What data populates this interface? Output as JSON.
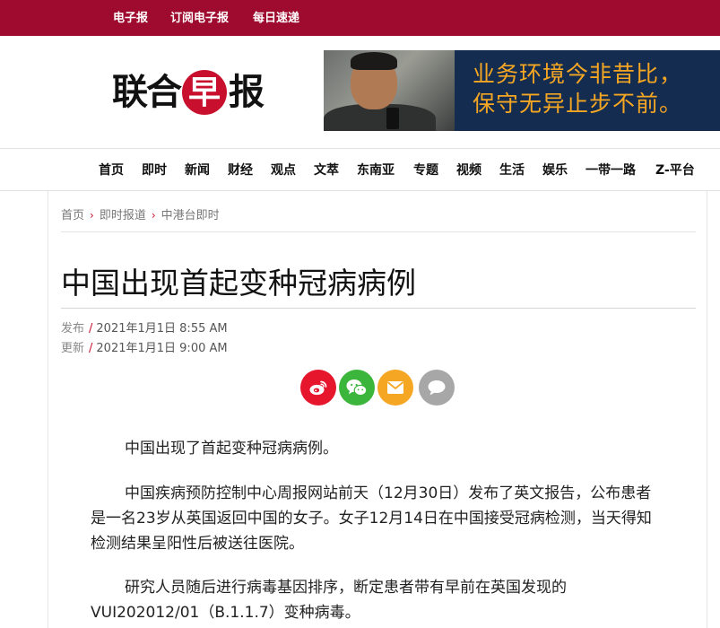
{
  "topbar": {
    "links": [
      "电子报",
      "订阅电子报",
      "每日速递"
    ]
  },
  "logo": {
    "chars": [
      "联",
      "合",
      "早",
      "报"
    ]
  },
  "banner": {
    "line1": "业务环境今非昔比，",
    "line2": "保守无异止步不前。"
  },
  "nav": {
    "items": [
      "首页",
      "即时",
      "新闻",
      "财经",
      "观点",
      "文萃",
      "东南亚",
      "专题",
      "视频",
      "生活",
      "娱乐",
      "一带一路",
      "Z-平台"
    ]
  },
  "breadcrumb": {
    "items": [
      "首页",
      "即时报道",
      "中港台即时"
    ],
    "separator": "›"
  },
  "article": {
    "title": "中国出现首起变种冠病病例",
    "published_label": "发布",
    "published": "2021年1月1日 8:55 AM",
    "updated_label": "更新",
    "updated": "2021年1月1日 9:00 AM",
    "meta_slash": "/",
    "paragraphs": [
      "中国出现了首起变种冠病病例。",
      "中国疾病预防控制中心周报网站前天（12月30日）发布了英文报告，公布患者是一名23岁从英国返回中国的女子。女子12月14日在中国接受冠病检测，当天得知检测结果呈阳性后被送往医院。",
      "研究人员随后进行病毒基因排序，断定患者带有早前在英国发现的VUI202012/01（B.1.1.7）变种病毒。"
    ]
  },
  "share": [
    {
      "icon": "weibo-icon",
      "color": "#e6162d"
    },
    {
      "icon": "wechat-icon",
      "color": "#3bb53b"
    },
    {
      "icon": "email-icon",
      "color": "#f5a623"
    },
    {
      "icon": "comment-icon",
      "color": "#a7a7a7"
    }
  ],
  "colors": {
    "brand": "#9e0b2e",
    "accent": "#c8102e",
    "banner_bg": "#132c4f",
    "banner_text": "#f5a623"
  }
}
